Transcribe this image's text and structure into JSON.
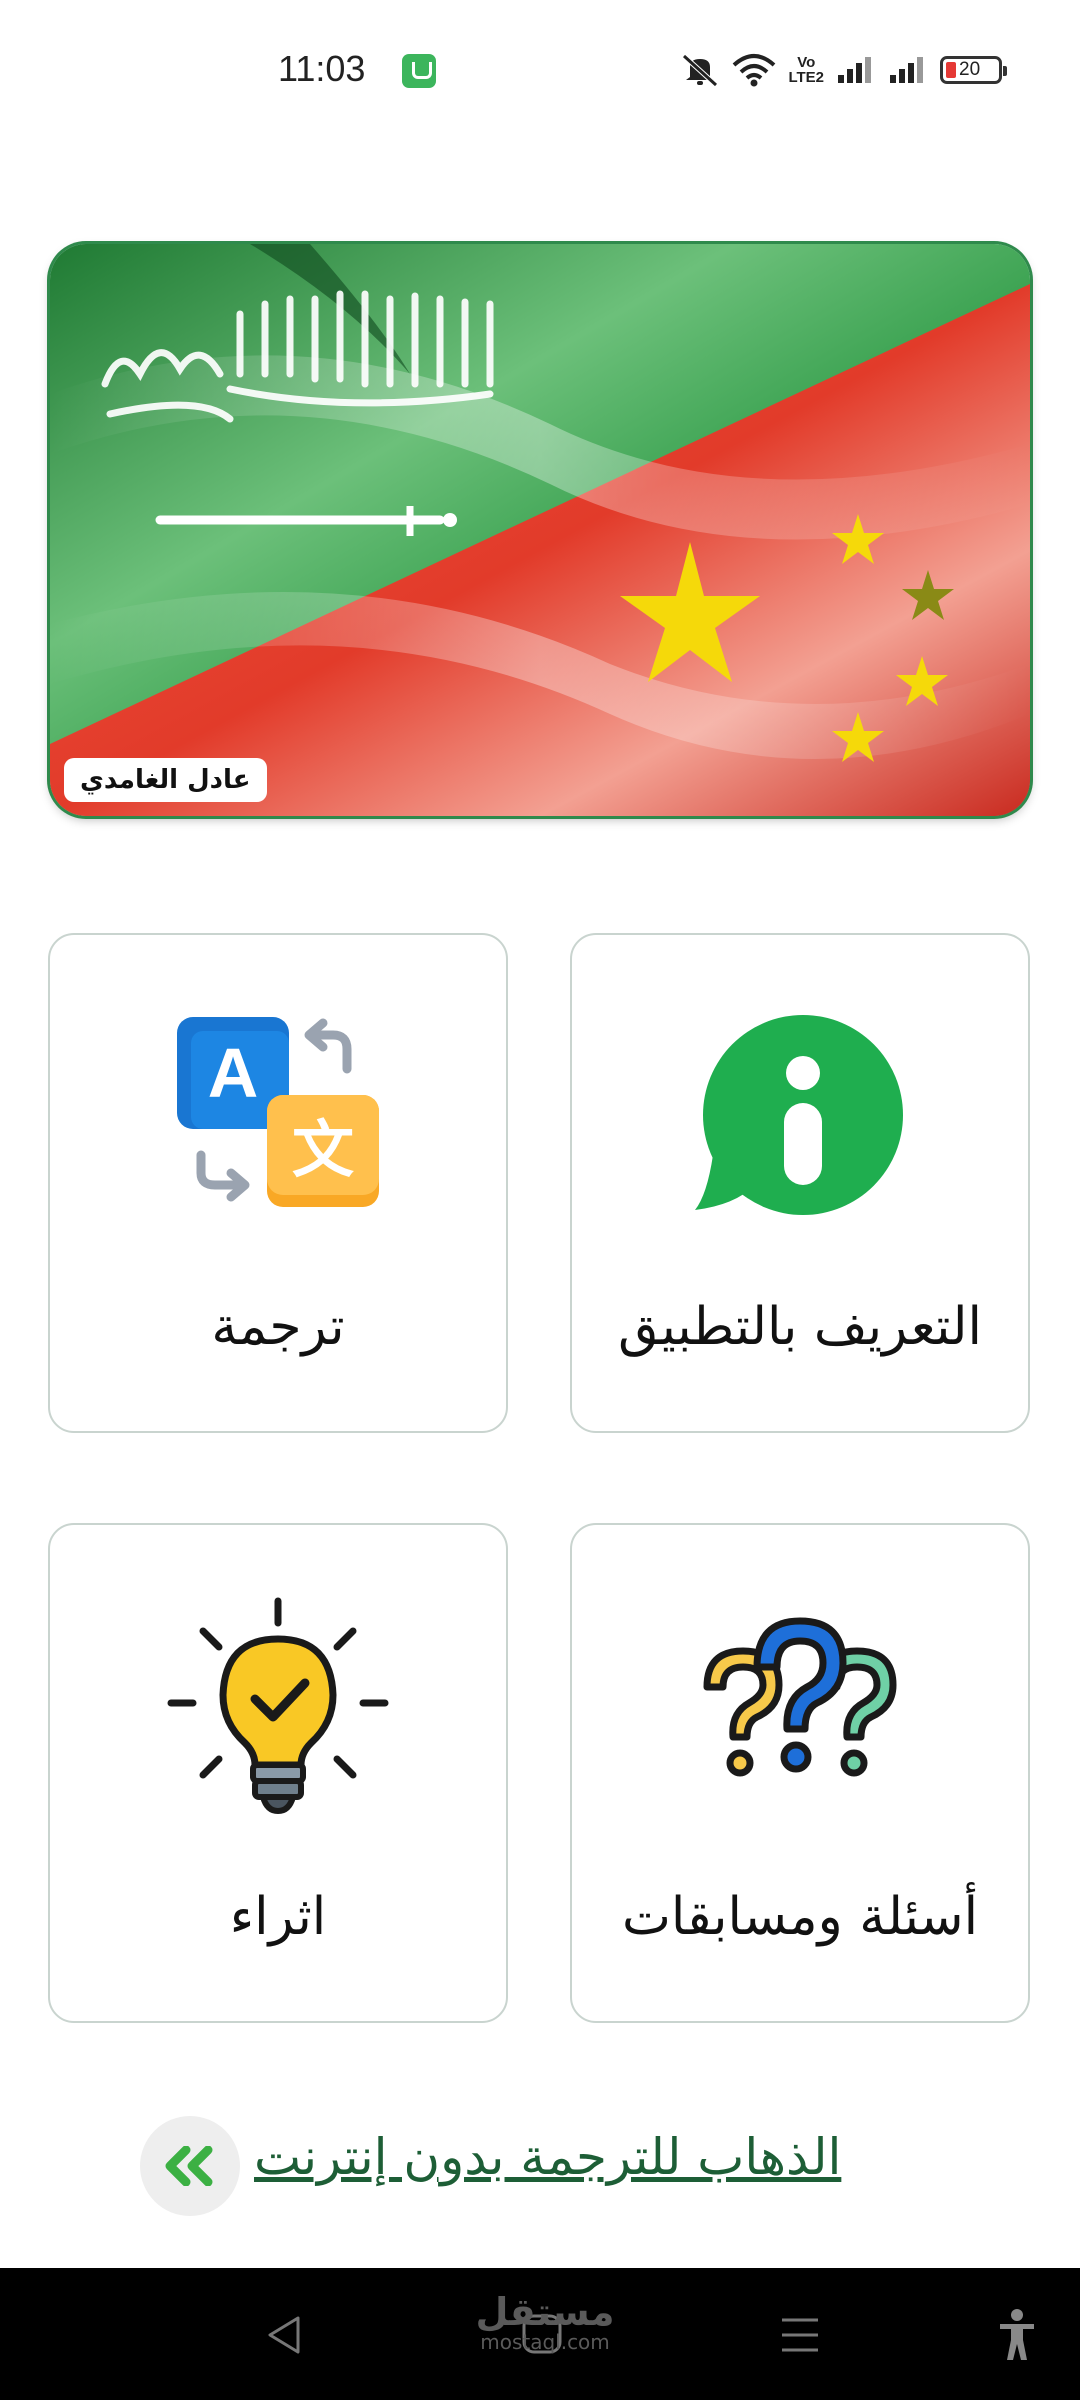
{
  "status_bar": {
    "time": "11:03",
    "network_label_top": "Vo",
    "network_label_bottom": "LTE2",
    "battery_level": "20"
  },
  "banner": {
    "author_tag": "عادل الغامدي",
    "flag_colors": {
      "saudi_green": "#2f9e44",
      "china_red": "#e5392b",
      "star_yellow": "#f5d90a"
    }
  },
  "cards": [
    {
      "id": "about",
      "label": "التعريف بالتطبيق",
      "icon": "info-chat-icon"
    },
    {
      "id": "translate",
      "label": "ترجمة",
      "icon": "translate-icon"
    },
    {
      "id": "quiz",
      "label": "أسئلة ومسابقات",
      "icon": "question-marks-icon"
    },
    {
      "id": "enrich",
      "label": "اثراء",
      "icon": "lightbulb-icon"
    }
  ],
  "offline": {
    "label": "الذهاب للترجمة بدون إنترنت",
    "accent": "#3cb043"
  },
  "nav_bar": {
    "watermark_main": "مستقل",
    "watermark_sub": "mostaql.com"
  }
}
